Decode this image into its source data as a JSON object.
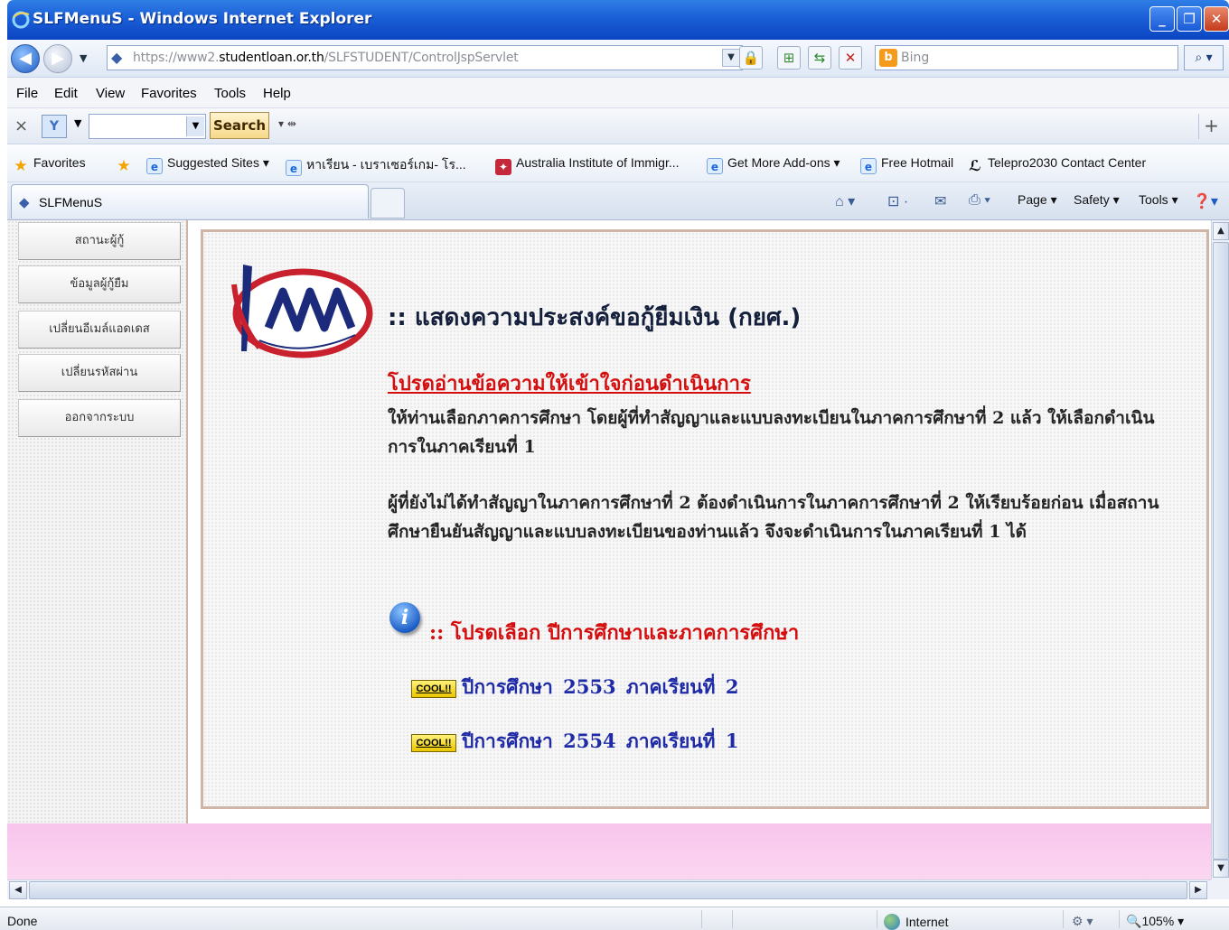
{
  "window": {
    "title": "SLFMenuS - Windows Internet Explorer",
    "minimize": "_",
    "restore": "❐",
    "close": "✕"
  },
  "address_bar": {
    "url_dim_prefix": "https://www2.",
    "url_domain": "studentloan.or.th",
    "url_path": "/SLFSTUDENT/ControlJspServlet",
    "search_placeholder": "Bing"
  },
  "menu": {
    "items": [
      "File",
      "Edit",
      "View",
      "Favorites",
      "Tools",
      "Help"
    ]
  },
  "toolbar": {
    "search_button": "Search"
  },
  "favorites_bar": {
    "favorites_label": "Favorites",
    "items": [
      "Suggested Sites ▾",
      "หาเรียน - เบราเซอร์เกม- โร...",
      "Australia Institute of Immigr...",
      "Get More Add-ons ▾",
      "Free Hotmail",
      "Telepro2030 Contact Center"
    ]
  },
  "tabs": {
    "active_tab": "SLFMenuS",
    "commands": [
      "Page ▾",
      "Safety ▾",
      "Tools ▾"
    ]
  },
  "sidebar": {
    "buttons": [
      "สถานะผู้กู้",
      "ข้อมูลผู้กู้ยืม",
      "เปลี่ยนอีเมล์แอดเดส",
      "เปลี่ยนรหัสผ่าน",
      "ออกจากระบบ"
    ]
  },
  "main": {
    "heading": ":: แสดงความประสงค์ขอกู้ยืมเงิน (กยศ.)",
    "notice": "โปรดอ่านข้อความให้เข้าใจก่อนดำเนินการ",
    "paragraph1": "ให้ท่านเลือกภาคการศึกษา โดยผู้ที่ทำสัญญาและแบบลงทะเบียนในภาคการศึกษาที่ 2 แล้ว ให้เลือกดำเนินการในภาคเรียนที่ 1",
    "paragraph2": "ผู้ที่ยังไม่ได้ทำสัญญาในภาคการศึกษาที่ 2 ต้องดำเนินการในภาคการศึกษาที่ 2 ให้เรียบร้อยก่อน เมื่อสถานศึกษายืนยันสัญญาและแบบลงทะเบียนของท่านแล้ว จึงจะดำเนินการในภาคเรียนที่ 1 ได้",
    "select_title": ":: โปรดเลือก ปีการศึกษาและภาคการศึกษา",
    "badge_text": "COOL!!",
    "options": [
      "ปีการศึกษา 2553 ภาคเรียนที่ 2",
      "ปีการศึกษา 2554 ภาคเรียนที่ 1"
    ]
  },
  "status_bar": {
    "status": "Done",
    "zone": "Internet",
    "zoom": "105%"
  },
  "colors": {
    "title_bar": "#1b5fd6",
    "notice_red": "#d40e0e",
    "link_blue": "#1e2aa6",
    "pink_strip": "#f8c4ec",
    "frame_border": "#cfb4a8"
  }
}
